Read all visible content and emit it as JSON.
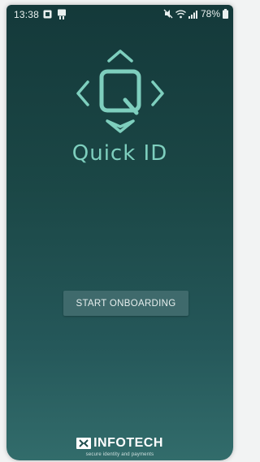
{
  "status_bar": {
    "time": "13:38",
    "battery": "78%",
    "icons": [
      "notification-icon",
      "app-icon",
      "mute-icon",
      "wifi-icon",
      "signal-icon",
      "battery-icon"
    ]
  },
  "app": {
    "name": "Quick ID",
    "logo_icon": "quick-id-logo-icon",
    "accent_color": "#7ecfbe"
  },
  "actions": {
    "start_label": "START ONBOARDING"
  },
  "footer": {
    "brand_name": "INFOTECH",
    "tagline": "secure identity and payments",
    "brand_mark_icon": "ex-infotech-logo-icon"
  }
}
